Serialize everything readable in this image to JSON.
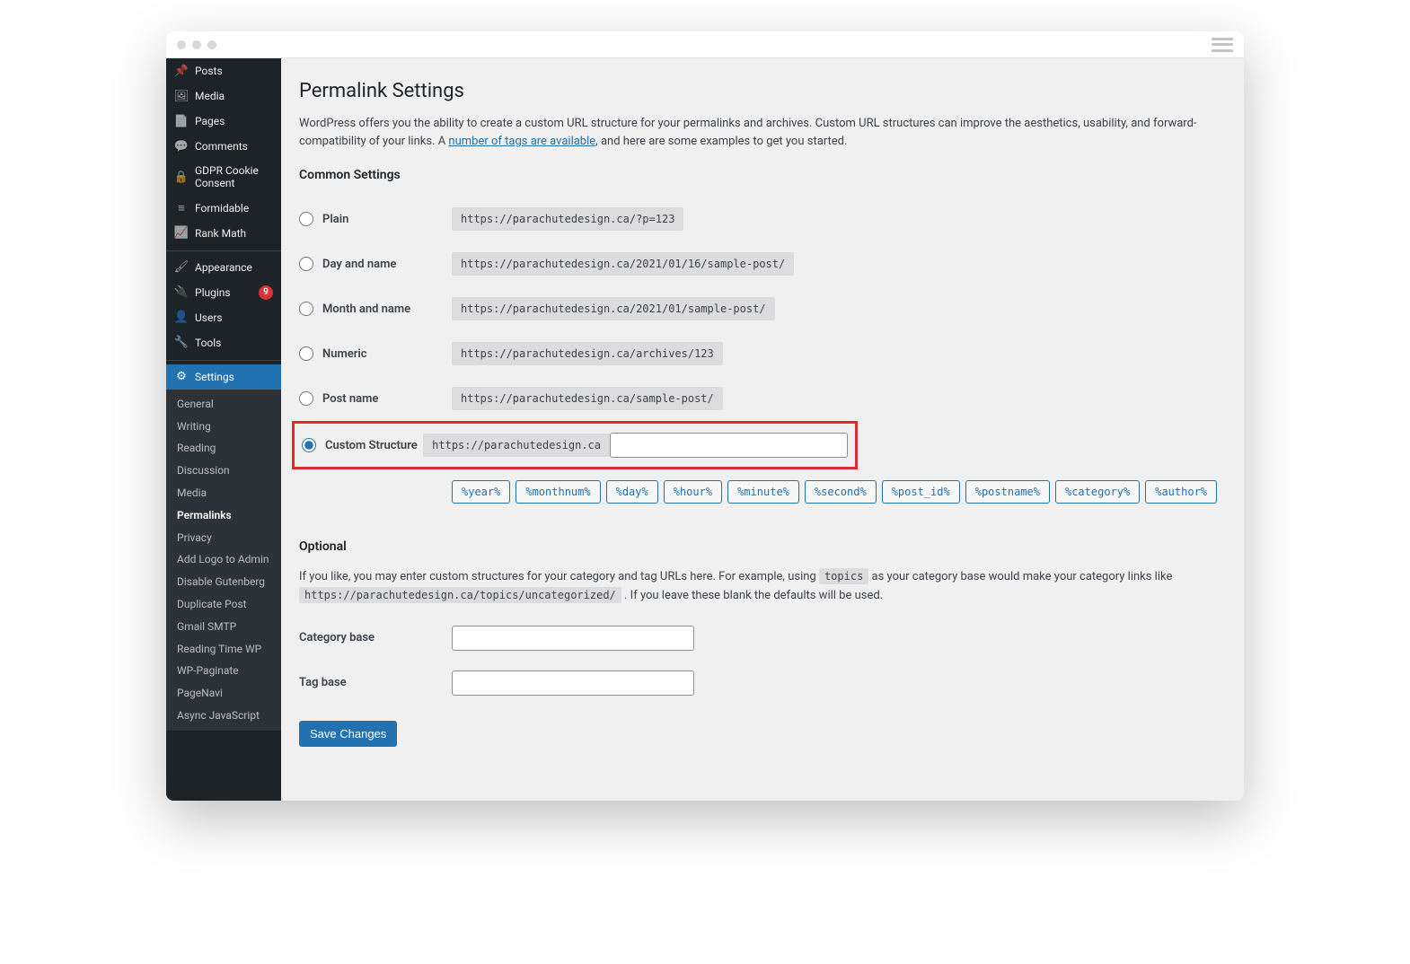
{
  "sidebar": {
    "items": [
      {
        "label": "Posts",
        "icon": "📌"
      },
      {
        "label": "Media",
        "icon": "🖼"
      },
      {
        "label": "Pages",
        "icon": "📄"
      },
      {
        "label": "Comments",
        "icon": "💬"
      },
      {
        "label": "GDPR Cookie Consent",
        "icon": "🔒"
      },
      {
        "label": "Formidable",
        "icon": "≡"
      },
      {
        "label": "Rank Math",
        "icon": "📈"
      },
      {
        "label": "Appearance",
        "icon": "🖌"
      },
      {
        "label": "Plugins",
        "icon": "🔌",
        "badge": "9"
      },
      {
        "label": "Users",
        "icon": "👤"
      },
      {
        "label": "Tools",
        "icon": "🔧"
      },
      {
        "label": "Settings",
        "icon": "⚙"
      }
    ],
    "sub": [
      "General",
      "Writing",
      "Reading",
      "Discussion",
      "Media",
      "Permalinks",
      "Privacy",
      "Add Logo to Admin",
      "Disable Gutenberg",
      "Duplicate Post",
      "Gmail SMTP",
      "Reading Time WP",
      "WP-Paginate",
      "PageNavi",
      "Async JavaScript"
    ],
    "sub_active": "Permalinks"
  },
  "page": {
    "title": "Permalink Settings",
    "desc_pre": "WordPress offers you the ability to create a custom URL structure for your permalinks and archives. Custom URL structures can improve the aesthetics, usability, and forward-compatibility of your links. A ",
    "desc_link": "number of tags are available",
    "desc_post": ", and here are some examples to get you started.",
    "common_heading": "Common Settings",
    "options": [
      {
        "label": "Plain",
        "example": "https://parachutedesign.ca/?p=123"
      },
      {
        "label": "Day and name",
        "example": "https://parachutedesign.ca/2021/01/16/sample-post/"
      },
      {
        "label": "Month and name",
        "example": "https://parachutedesign.ca/2021/01/sample-post/"
      },
      {
        "label": "Numeric",
        "example": "https://parachutedesign.ca/archives/123"
      },
      {
        "label": "Post name",
        "example": "https://parachutedesign.ca/sample-post/"
      }
    ],
    "custom_label": "Custom Structure",
    "base_url": "https://parachutedesign.ca",
    "custom_value": "",
    "tags": [
      "%year%",
      "%monthnum%",
      "%day%",
      "%hour%",
      "%minute%",
      "%second%",
      "%post_id%",
      "%postname%",
      "%category%",
      "%author%"
    ],
    "optional_heading": "Optional",
    "opt_pre": "If you like, you may enter custom structures for your category and tag URLs here. For example, using ",
    "opt_code1": "topics",
    "opt_mid": " as your category base would make your category links like ",
    "opt_code2": "https://parachutedesign.ca/topics/uncategorized/",
    "opt_post": " . If you leave these blank the defaults will be used.",
    "category_label": "Category base",
    "tag_label": "Tag base",
    "save_label": "Save Changes"
  }
}
